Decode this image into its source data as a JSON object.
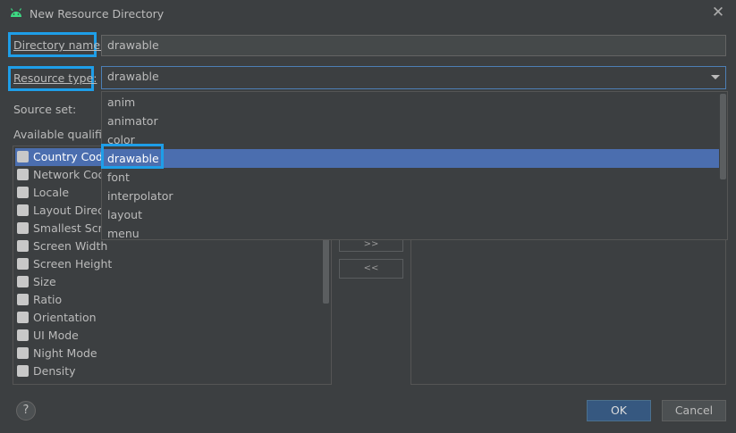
{
  "window": {
    "title": "New Resource Directory",
    "close_glyph": "✕"
  },
  "form": {
    "directory_name_label": "Directory name:",
    "directory_name_value": "drawable",
    "resource_type_label": "Resource type:",
    "resource_type_value": "drawable",
    "source_set_label": "Source set:",
    "available_qualifiers_label": "Available qualifier"
  },
  "resource_type_options": [
    {
      "label": "anim",
      "selected": false
    },
    {
      "label": "animator",
      "selected": false
    },
    {
      "label": "color",
      "selected": false
    },
    {
      "label": "drawable",
      "selected": true
    },
    {
      "label": "font",
      "selected": false
    },
    {
      "label": "interpolator",
      "selected": false
    },
    {
      "label": "layout",
      "selected": false
    },
    {
      "label": "menu",
      "selected": false
    }
  ],
  "qualifiers": [
    {
      "label": "Country Code",
      "icon": "country-code-icon",
      "selected": true
    },
    {
      "label": "Network Code",
      "icon": "network-code-icon",
      "selected": false
    },
    {
      "label": "Locale",
      "icon": "globe-icon",
      "selected": false
    },
    {
      "label": "Layout Directi",
      "icon": "layout-direction-icon",
      "selected": false
    },
    {
      "label": "Smallest Scre",
      "icon": "smallest-screen-icon",
      "selected": false
    },
    {
      "label": "Screen Width",
      "icon": "screen-width-icon",
      "selected": false
    },
    {
      "label": "Screen Height",
      "icon": "screen-height-icon",
      "selected": false
    },
    {
      "label": "Size",
      "icon": "size-icon",
      "selected": false
    },
    {
      "label": "Ratio",
      "icon": "ratio-icon",
      "selected": false
    },
    {
      "label": "Orientation",
      "icon": "orientation-icon",
      "selected": false
    },
    {
      "label": "UI Mode",
      "icon": "ui-mode-icon",
      "selected": false
    },
    {
      "label": "Night Mode",
      "icon": "night-mode-icon",
      "selected": false
    },
    {
      "label": "Density",
      "icon": "density-icon",
      "selected": false
    }
  ],
  "transfer": {
    "add_label": ">>",
    "remove_label": "<<"
  },
  "buttons": {
    "help_label": "?",
    "ok_label": "OK",
    "cancel_label": "Cancel"
  },
  "colors": {
    "accent_highlight": "#1e9ee8",
    "selection": "#4b6eaf",
    "background": "#3c3f41"
  }
}
